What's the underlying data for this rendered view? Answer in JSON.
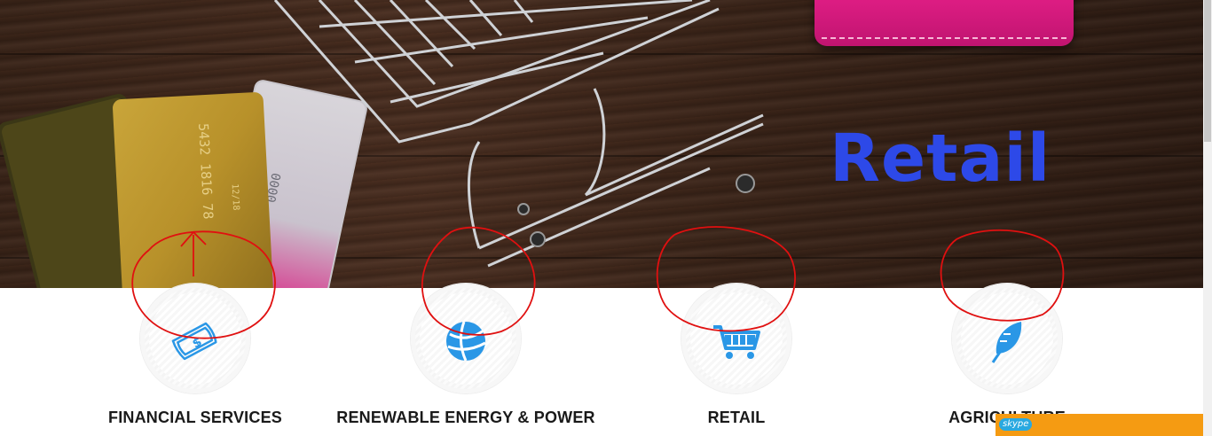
{
  "hero": {
    "title": "Retail",
    "title_color": "#2d49e8"
  },
  "industries": [
    {
      "label": "FINANCIAL SERVICES",
      "icon": "money-hand-icon"
    },
    {
      "label": "RENEWABLE ENERGY & POWER",
      "icon": "globe-icon"
    },
    {
      "label": "RETAIL",
      "icon": "shopping-cart-icon"
    },
    {
      "label": "AGRICULTURE",
      "icon": "leaf-icon"
    }
  ],
  "colors": {
    "icon_blue": "#2a97e6",
    "annotation_red": "#e01010",
    "skype_orange": "#f59b12"
  },
  "skype": {
    "label": "skype"
  }
}
